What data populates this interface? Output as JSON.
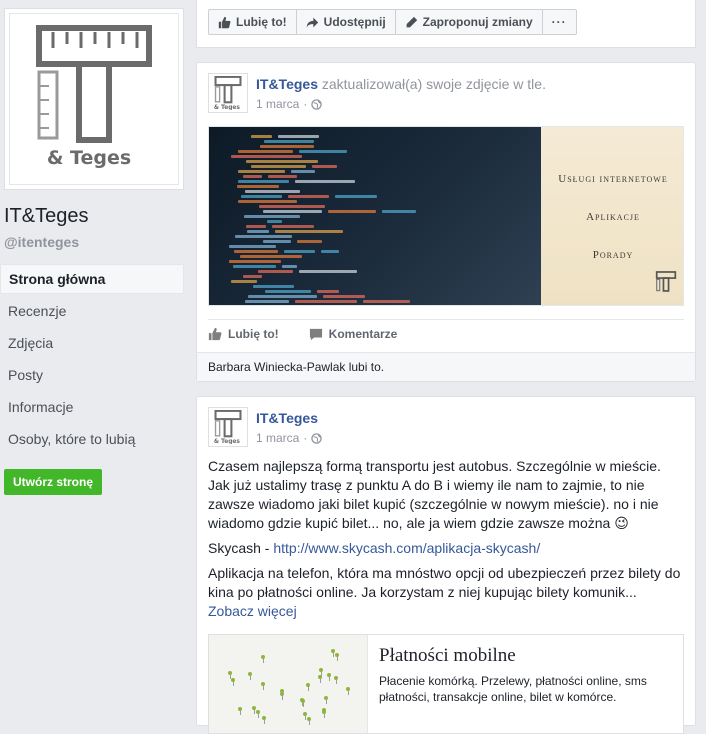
{
  "page": {
    "name": "IT&Teges",
    "handle": "@itenteges",
    "logo_text": "& Teges"
  },
  "nav": {
    "items": [
      {
        "label": "Strona główna",
        "active": true
      },
      {
        "label": "Recenzje"
      },
      {
        "label": "Zdjęcia"
      },
      {
        "label": "Posty"
      },
      {
        "label": "Informacje"
      },
      {
        "label": "Osoby, które to lubią"
      }
    ],
    "create_page": "Utwórz stronę"
  },
  "actions": {
    "like": "Lubię to!",
    "share": "Udostępnij",
    "suggest": "Zaproponuj zmiany",
    "more": "···"
  },
  "post1": {
    "author": "IT&Teges",
    "action_text": "zaktualizował(a) swoje zdjęcie w tle.",
    "date": "1 marca",
    "cover": {
      "line1": "Usługi internetowe",
      "line2": "Aplikacje",
      "line3": "Porady"
    },
    "like_label": "Lubię to!",
    "comment_label": "Komentarze",
    "likes_summary": "Barbara Winiecka-Pawlak lubi to."
  },
  "post2": {
    "author": "IT&Teges",
    "date": "1 marca",
    "text1": "Czasem najlepszą formą transportu jest autobus. Szczególnie w mieście. Jak już ustalimy trasę z punktu A do B i wiemy ile nam to zajmie, to nie zawsze wiadomo jaki bilet kupić (szczególnie w nowym mieście). no i nie wiadomo gdzie kupić bilet... no, ale ja wiem gdzie zawsze można",
    "emoji": "😉",
    "skycash_label": "Skycash -",
    "skycash_url": "http://www.skycash.com/aplikacja-skycash/",
    "text2": "Aplikacja na telefon, która ma mnóstwo opcji od ubezpieczeń przez bilety do kina po płatności online. Ja korzystam z niej kupując bilety komunik...",
    "see_more": "Zobacz więcej",
    "link_title": "Płatności mobilne",
    "link_desc": "Płacenie komórką. Przelewy, płatności online, sms płatności, transakcje online, bilet w komórce."
  },
  "colors": {
    "background": "#e9ebee",
    "link": "#365899",
    "create_button": "#42b72a"
  },
  "icons": [
    "thumbs-up-icon",
    "share-arrow-icon",
    "pencil-icon",
    "more-icon",
    "globe-icon",
    "comment-icon",
    "logo-icon"
  ]
}
